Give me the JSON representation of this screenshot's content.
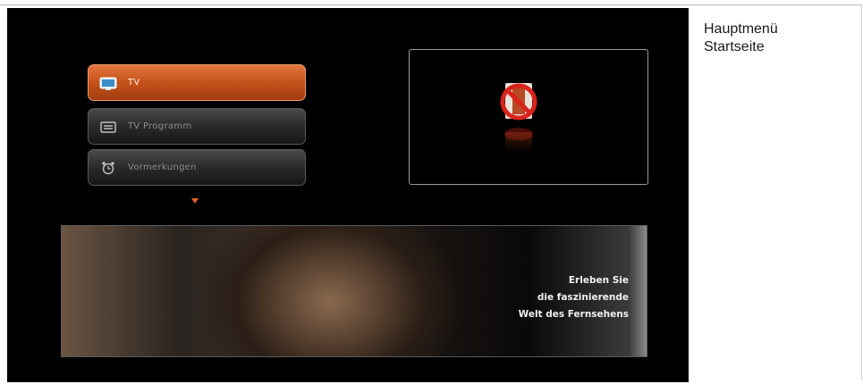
{
  "caption": {
    "line1": "Hauptmenü",
    "line2": "Startseite"
  },
  "menu": {
    "items": [
      {
        "label": "TV",
        "icon": "tv-icon",
        "active": true
      },
      {
        "label": "TV Programm",
        "icon": "tv-guide-icon",
        "active": false
      },
      {
        "label": "Vormerkungen",
        "icon": "alarm-clock-icon",
        "active": false
      }
    ],
    "scroll_indicator": "chevron-down-icon"
  },
  "preview": {
    "icon": "no-signal-icon"
  },
  "banner": {
    "line1": "Erleben Sie",
    "line2": "die faszinierende",
    "line3": "Welt des Fernsehens"
  },
  "colors": {
    "accent": "#c9541d",
    "screen_bg": "#000000",
    "inactive_text": "#8c8c8c"
  }
}
